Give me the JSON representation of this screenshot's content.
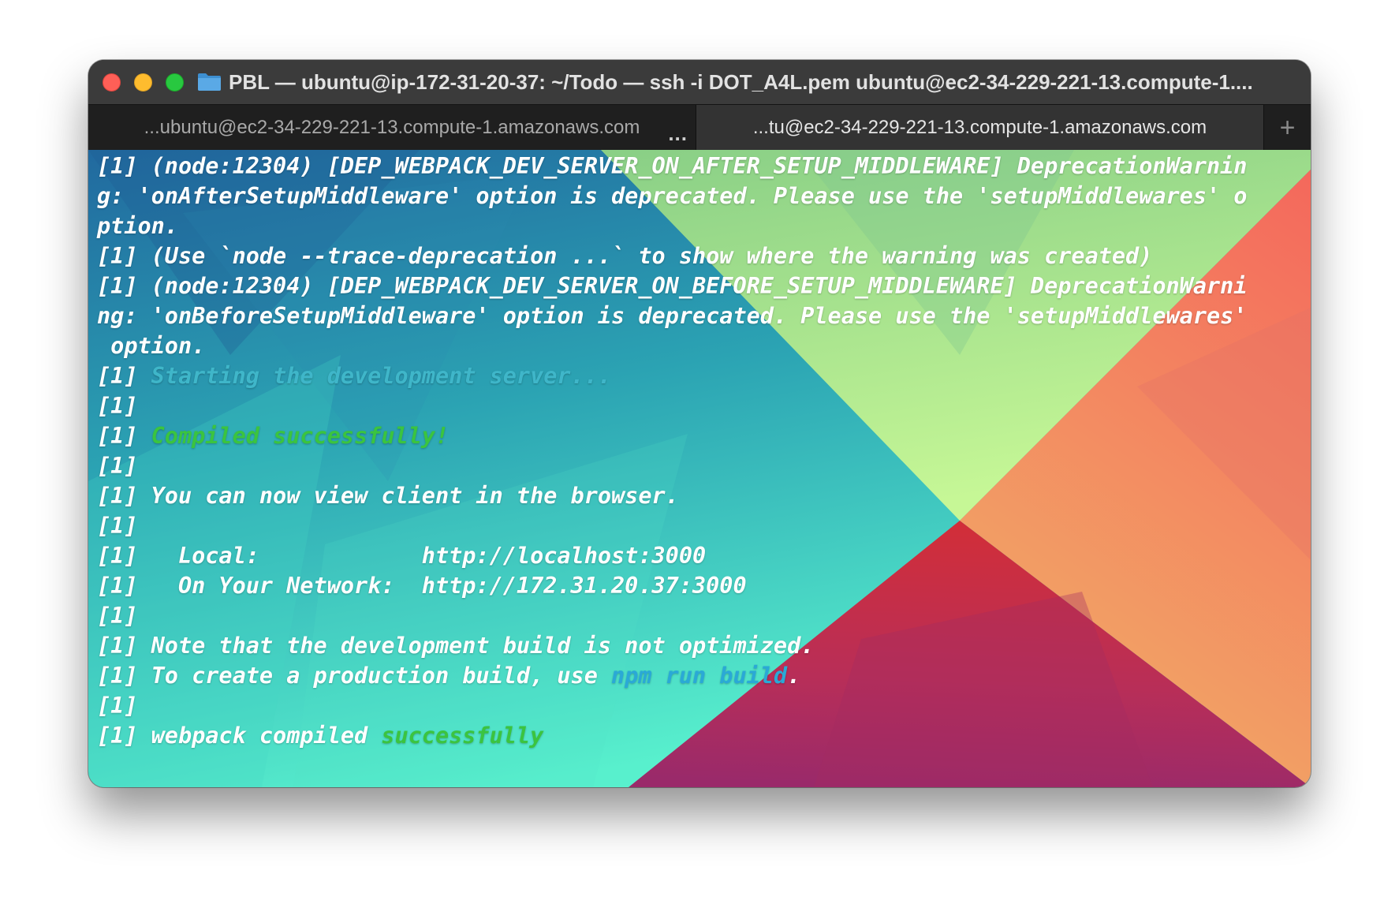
{
  "window": {
    "title": "PBL — ubuntu@ip-172-31-20-37: ~/Todo — ssh -i DOT_A4L.pem ubuntu@ec2-34-229-221-13.compute-1....",
    "tabs": [
      {
        "label": "...ubuntu@ec2-34-229-221-13.compute-1.amazonaws.com",
        "more": "...",
        "active": false
      },
      {
        "label": "...tu@ec2-34-229-221-13.compute-1.amazonaws.com",
        "active": true
      }
    ],
    "new_tab_label": "+"
  },
  "colors": {
    "cyan_text": "#3fb6c9",
    "green_text": "#3bc43f",
    "blue_text": "#2aa9d6"
  },
  "terminal": {
    "lines": [
      {
        "segments": [
          {
            "text": "[1] (node:12304) [DEP_WEBPACK_DEV_SERVER_ON_AFTER_SETUP_MIDDLEWARE] DeprecationWarnin",
            "color": "white"
          }
        ]
      },
      {
        "segments": [
          {
            "text": "g: 'onAfterSetupMiddleware' option is deprecated. Please use the 'setupMiddlewares' o",
            "color": "white"
          }
        ]
      },
      {
        "segments": [
          {
            "text": "ption.",
            "color": "white"
          }
        ]
      },
      {
        "segments": [
          {
            "text": "[1] (Use `node --trace-deprecation ...` to show where the warning was created)",
            "color": "white"
          }
        ]
      },
      {
        "segments": [
          {
            "text": "[1] (node:12304) [DEP_WEBPACK_DEV_SERVER_ON_BEFORE_SETUP_MIDDLEWARE] DeprecationWarni",
            "color": "white"
          }
        ]
      },
      {
        "segments": [
          {
            "text": "ng: 'onBeforeSetupMiddleware' option is deprecated. Please use the 'setupMiddlewares'",
            "color": "white"
          }
        ]
      },
      {
        "segments": [
          {
            "text": " option.",
            "color": "white"
          }
        ]
      },
      {
        "segments": [
          {
            "text": "[1] ",
            "color": "white"
          },
          {
            "text": "Starting the development server...",
            "color": "cyan"
          }
        ]
      },
      {
        "segments": [
          {
            "text": "[1]",
            "color": "white"
          }
        ]
      },
      {
        "segments": [
          {
            "text": "[1] ",
            "color": "white"
          },
          {
            "text": "Compiled successfully!",
            "color": "green"
          }
        ]
      },
      {
        "segments": [
          {
            "text": "[1]",
            "color": "white"
          }
        ]
      },
      {
        "segments": [
          {
            "text": "[1] You can now view client in the browser.",
            "color": "white"
          }
        ]
      },
      {
        "segments": [
          {
            "text": "[1]",
            "color": "white"
          }
        ]
      },
      {
        "segments": [
          {
            "text": "[1]   Local:            http://localhost:3000",
            "color": "white"
          }
        ]
      },
      {
        "segments": [
          {
            "text": "[1]   On Your Network:  http://172.31.20.37:3000",
            "color": "white"
          }
        ]
      },
      {
        "segments": [
          {
            "text": "[1]",
            "color": "white"
          }
        ]
      },
      {
        "segments": [
          {
            "text": "[1] Note that the development build is not optimized.",
            "color": "white"
          }
        ]
      },
      {
        "segments": [
          {
            "text": "[1] To create a production build, use ",
            "color": "white"
          },
          {
            "text": "npm run build",
            "color": "blue"
          },
          {
            "text": ".",
            "color": "white"
          }
        ]
      },
      {
        "segments": [
          {
            "text": "[1]",
            "color": "white"
          }
        ]
      },
      {
        "segments": [
          {
            "text": "[1] webpack compiled ",
            "color": "white"
          },
          {
            "text": "successfully",
            "color": "green"
          }
        ]
      }
    ]
  }
}
